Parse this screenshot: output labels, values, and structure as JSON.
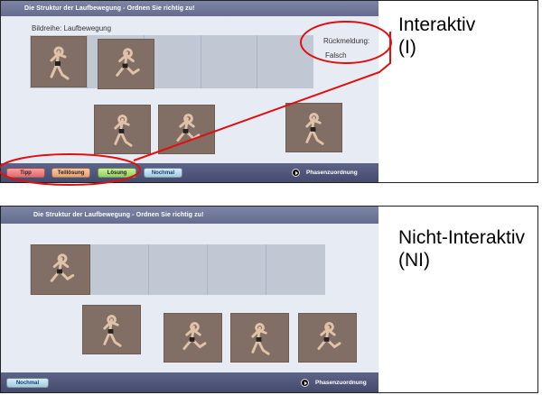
{
  "interactive": {
    "title": "Die Struktur der Laufbewegung - Ordnen Sie richtig zu!",
    "subtitle": "Bildreihe: Laufbewegung",
    "feedback_label": "Rückmeldung:",
    "feedback_value": "Falsch",
    "buttons": {
      "tipp": "Tipp",
      "teil": "Teillösung",
      "loesung": "Lösung",
      "nochmal": "Nochmal"
    },
    "phase": "Phasenzuordnung",
    "caption_line1": "Interaktiv",
    "caption_line2": "(I)"
  },
  "noninteractive": {
    "title": "Die Struktur der Laufbewegung - Ordnen Sie richtig zu!",
    "buttons": {
      "nochmal": "Nochmal"
    },
    "phase": "Phasenzuordnung",
    "caption_line1": "Nicht-Interaktiv",
    "caption_line2": "(NI)"
  },
  "colors": {
    "highlight": "#e01010",
    "titlebar": "#6f7698",
    "bottombar": "#4f5679",
    "card": "#816e64",
    "slot": "#c1c8d4"
  },
  "icons": [
    "play-icon",
    "runner-figure"
  ]
}
